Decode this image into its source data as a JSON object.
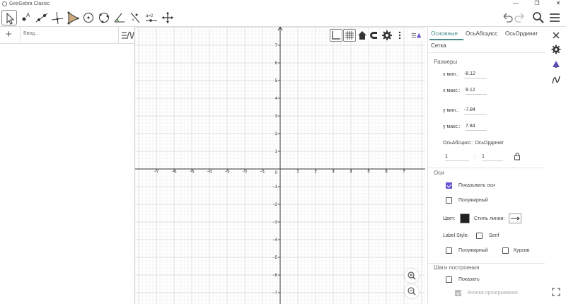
{
  "window": {
    "title": "GeoGebra Classic"
  },
  "toolbar": {
    "tools": [
      {
        "name": "move-tool",
        "icon": "cursor-arrow-icon"
      },
      {
        "name": "point-tool",
        "icon": "point-icon",
        "label": "A"
      },
      {
        "name": "line-tool",
        "icon": "line-icon"
      },
      {
        "name": "perpendicular-line-tool",
        "icon": "perpendicular-line-icon"
      },
      {
        "name": "polygon-tool",
        "icon": "polygon-icon"
      },
      {
        "name": "circle-center-point-tool",
        "icon": "circle-center-icon"
      },
      {
        "name": "circle-three-points-tool",
        "icon": "circle-points-icon"
      },
      {
        "name": "angle-tool",
        "icon": "angle-icon"
      },
      {
        "name": "reflect-tool",
        "icon": "reflect-icon"
      },
      {
        "name": "slider-tool",
        "icon": "slider-icon",
        "label": "a=2"
      },
      {
        "name": "move-graphics-tool",
        "icon": "move-view-icon"
      }
    ]
  },
  "algebra": {
    "placeholder": "Ввод..."
  },
  "graph": {
    "x_ticks": [
      -7,
      -6,
      -5,
      -4,
      -3,
      -2,
      -1,
      1,
      2,
      3,
      4,
      5,
      6,
      7
    ],
    "y_ticks": [
      7,
      6,
      5,
      4,
      3,
      2,
      1,
      -1,
      -2,
      -3,
      -4,
      -5,
      -6,
      -7
    ],
    "origin_label": "0"
  },
  "props": {
    "tabs": [
      "Основные",
      "ОсьАбсцисс",
      "ОсьОрдинат",
      "Сетка"
    ],
    "active_tab": 0,
    "dimensions_title": "Размеры",
    "xmin_label": "x мин.:",
    "xmin_value": "-8.12",
    "xmax_label": "x макс.:",
    "xmax_value": "8.12",
    "ymin_label": "y мин.:",
    "ymin_value": "-7.84",
    "ymax_label": "y макс.:",
    "ymax_value": "7.84",
    "ratio_label": "ОсьАбсцисс : ОсьОрдинат",
    "ratio_x": "1",
    "ratio_sep": ":",
    "ratio_y": "1",
    "axes_title": "Оси",
    "show_axes_label": "Показывать оси",
    "show_axes": true,
    "bold_label": "Полужирный",
    "bold": false,
    "color_label": "Цвет:",
    "axis_color": "#222222",
    "line_style_label": "Стиль линии:",
    "label_style_label": "Label Style:",
    "serif_label": "Serif",
    "serif": false,
    "bold2_label": "Полужирный",
    "bold2": false,
    "italic_label": "Курсив",
    "italic": false,
    "construction_title": "Шаги построения",
    "show_label": "Показать",
    "show": false,
    "play_button_label": "Кнопка проигрывания"
  },
  "colors": {
    "accent": "#4a8a8e",
    "checkbox": "#6557d2"
  }
}
